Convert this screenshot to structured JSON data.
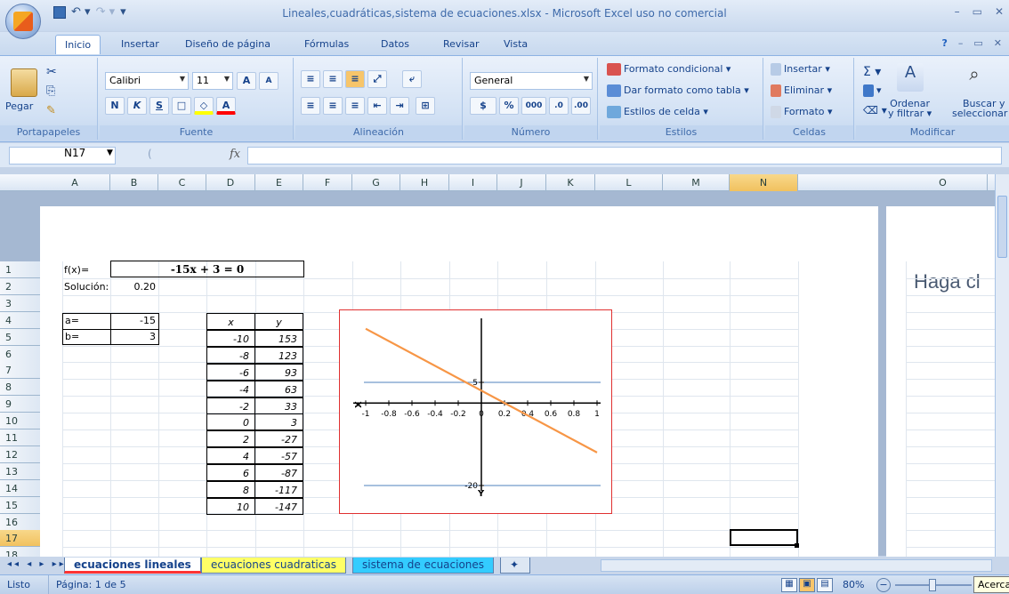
{
  "window": {
    "title": "Lineales,cuadráticas,sistema de ecuaciones.xlsx - Microsoft Excel uso no comercial",
    "office_logo": "Office"
  },
  "tabs": [
    "Inicio",
    "Insertar",
    "Diseño de página",
    "Fórmulas",
    "Datos",
    "Revisar",
    "Vista"
  ],
  "ribbon": {
    "clipboard": {
      "label": "Portapapeles",
      "paste": "Pegar"
    },
    "font": {
      "label": "Fuente",
      "name": "Calibri",
      "size": "11",
      "bold": "N",
      "italic": "K",
      "underline": "S"
    },
    "alignment": {
      "label": "Alineación"
    },
    "number": {
      "label": "Número",
      "format": "General",
      "currency": "$",
      "percent": "%",
      "thousands": "000"
    },
    "styles": {
      "label": "Estilos",
      "conditional": "Formato condicional",
      "as_table": "Dar formato como tabla",
      "cell_styles": "Estilos de celda"
    },
    "cells": {
      "label": "Celdas",
      "insert": "Insertar",
      "delete": "Eliminar",
      "format": "Formato"
    },
    "edit": {
      "label": "Modificar",
      "sort": "Ordenar y filtrar",
      "sort_1": "Ordenar",
      "sort_2": "y filtrar",
      "find": "Buscar y seleccionar",
      "find_1": "Buscar y",
      "find_2": "seleccionar"
    }
  },
  "formula_bar": {
    "name_box": "N17",
    "fx": "fx",
    "formula": ""
  },
  "columns": [
    "A",
    "B",
    "C",
    "D",
    "E",
    "F",
    "G",
    "H",
    "I",
    "J",
    "K",
    "L",
    "M",
    "N",
    "O"
  ],
  "rows": [
    "1",
    "2",
    "3",
    "4",
    "5",
    "6",
    "7",
    "8",
    "9",
    "10",
    "11",
    "12",
    "13",
    "14",
    "15",
    "16",
    "17",
    "18"
  ],
  "cells": {
    "fx_label": "f(x)=",
    "equation": "-15x + 3 = 0",
    "solution_label": "Solución:",
    "solution_value": "0.20",
    "a_label": "a=",
    "a_value": "-15",
    "b_label": "b=",
    "b_value": "3"
  },
  "table": {
    "headers": [
      "x",
      "y"
    ],
    "rows": [
      [
        "-10",
        "153"
      ],
      [
        "-8",
        "123"
      ],
      [
        "-6",
        "93"
      ],
      [
        "-4",
        "63"
      ],
      [
        "-2",
        "33"
      ],
      [
        "0",
        "3"
      ],
      [
        "2",
        "-27"
      ],
      [
        "4",
        "-57"
      ],
      [
        "6",
        "-87"
      ],
      [
        "8",
        "-117"
      ],
      [
        "10",
        "-147"
      ]
    ]
  },
  "chart_data": {
    "type": "line",
    "x": [
      -1,
      1
    ],
    "y": [
      18,
      -12
    ],
    "xticks": [
      "-1",
      "-0.8",
      "-0.6",
      "-0.4",
      "-0.2",
      "0",
      "0.2",
      "0.4",
      "0.6",
      "0.8",
      "1"
    ],
    "y_tick_labels": [
      "5",
      "-20"
    ],
    "x_axis_letter": "X",
    "y_axis_letter": "Y",
    "line_color": "#f79646",
    "border_color": "#e03030",
    "gridline_color": "#4f81bd"
  },
  "right_page_text": "Haga cl",
  "sheet_tabs": [
    "ecuaciones lineales",
    "ecuaciones cuadraticas",
    "sistema de ecuaciones"
  ],
  "sheet_tab_colors": [
    "#ff3333",
    "#ffff66",
    "#33ccff"
  ],
  "status": {
    "ready": "Listo",
    "page": "Página: 1 de 5",
    "zoom": "80%",
    "zoom_tip": "Acerca"
  }
}
